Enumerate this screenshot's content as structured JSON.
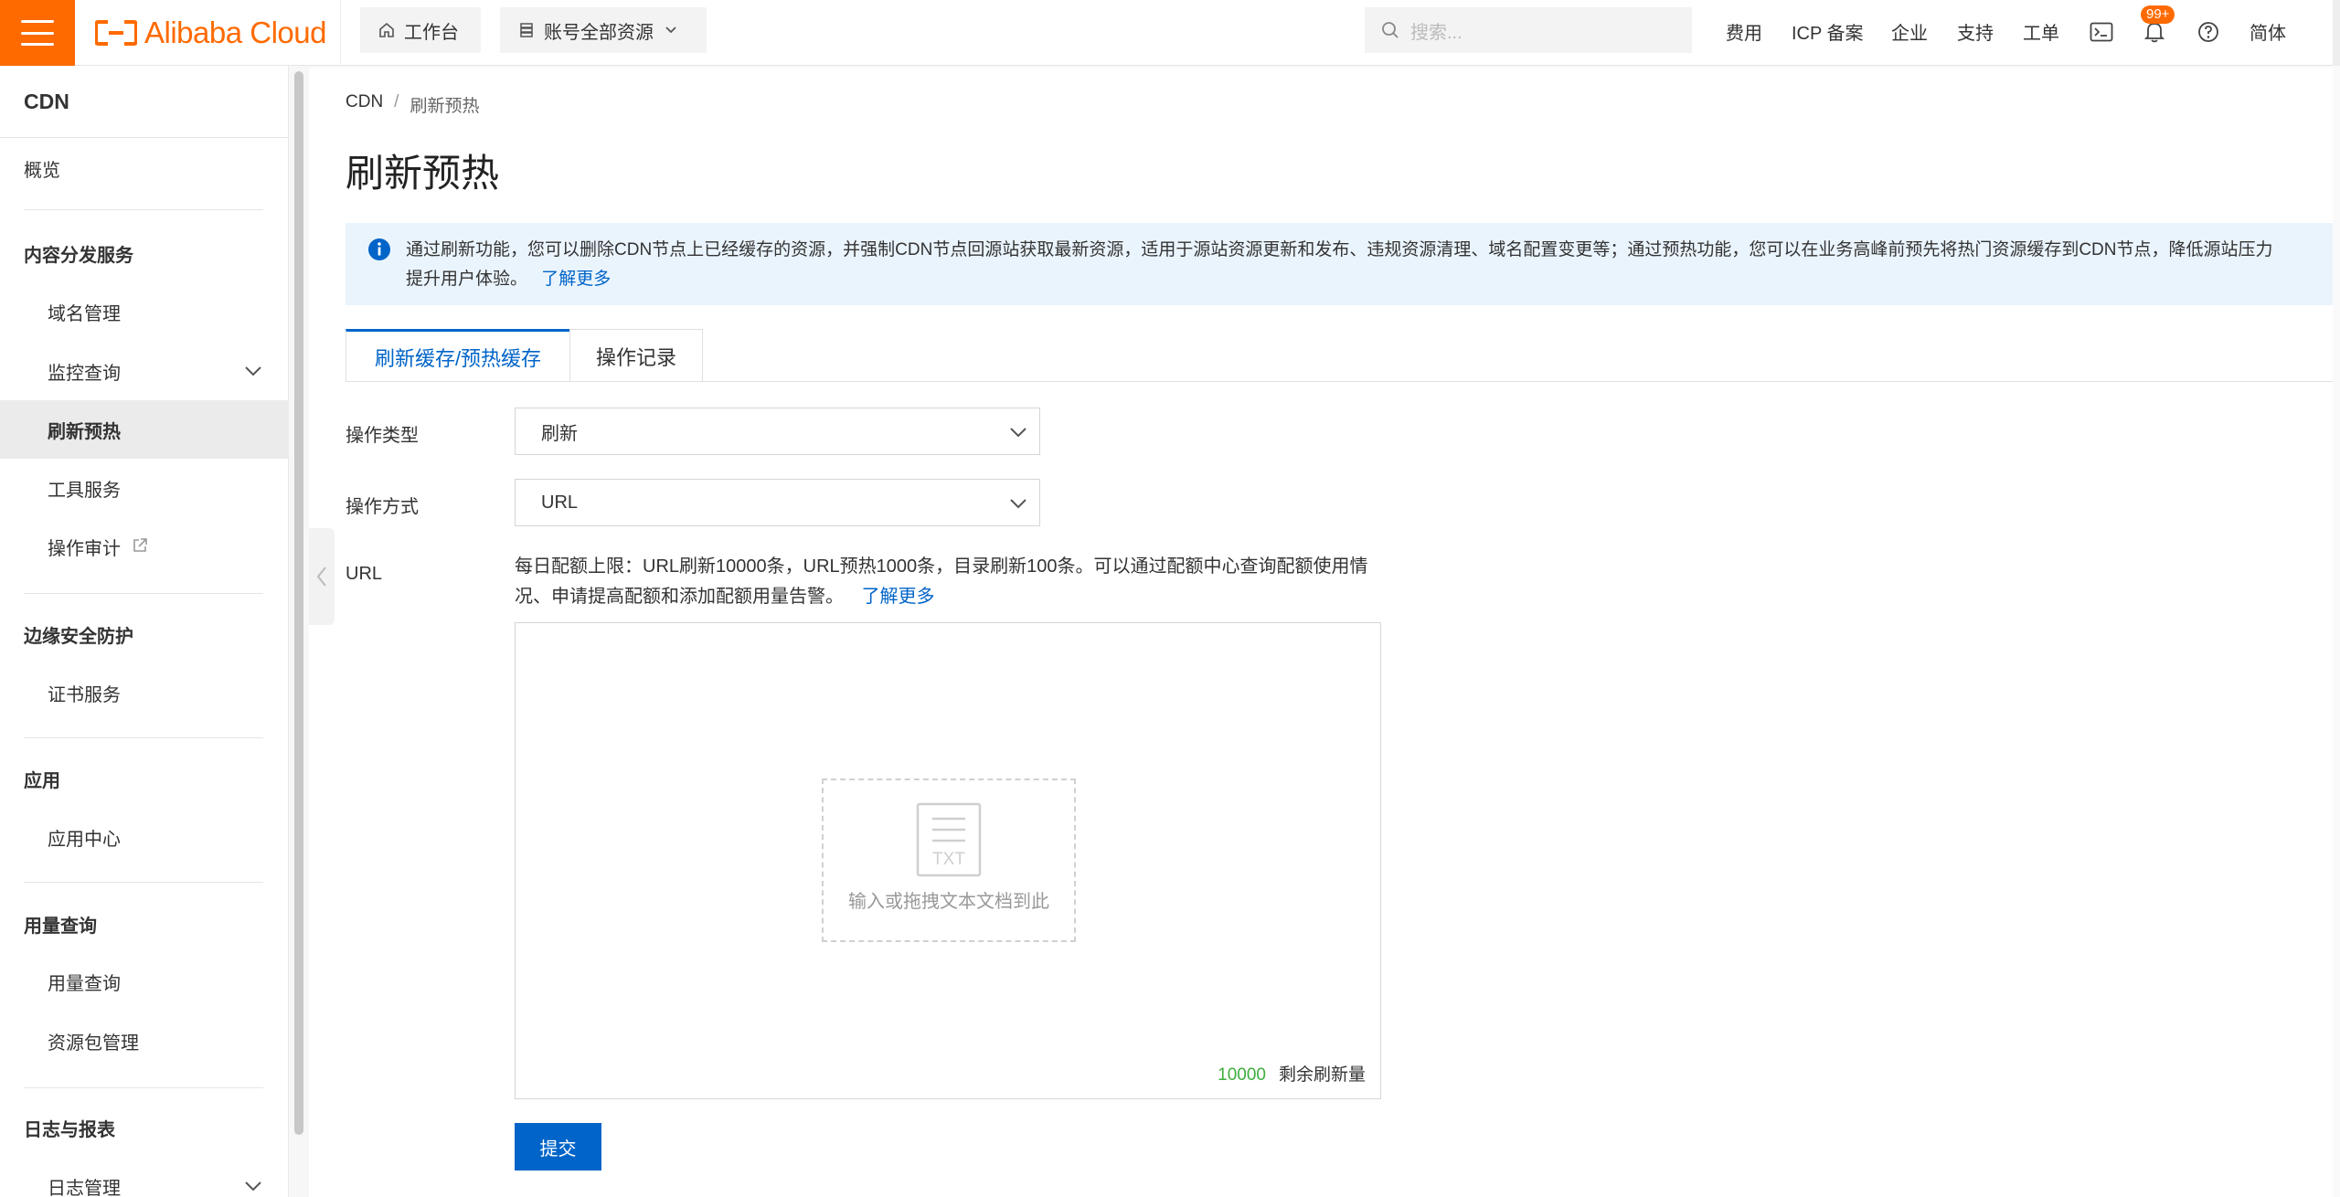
{
  "topbar": {
    "brand": "Alibaba Cloud",
    "workbench": "工作台",
    "resources": "账号全部资源",
    "search_placeholder": "搜索...",
    "links": [
      "费用",
      "ICP 备案",
      "企业",
      "支持",
      "工单"
    ],
    "badge": "99+",
    "language": "简体",
    "accent_color": "#ff6a00"
  },
  "sidebar": {
    "title": "CDN",
    "overview": "概览",
    "groups": [
      {
        "label": "内容分发服务",
        "items": [
          "域名管理",
          "监控查询",
          "刷新预热",
          "工具服务",
          "操作审计"
        ]
      },
      {
        "label": "边缘安全防护",
        "items": [
          "证书服务"
        ]
      },
      {
        "label": "应用",
        "items": [
          "应用中心"
        ]
      },
      {
        "label": "用量查询",
        "items": [
          "用量查询",
          "资源包管理"
        ]
      },
      {
        "label": "日志与报表",
        "items": [
          "日志管理"
        ]
      }
    ],
    "active_item": "刷新预热"
  },
  "breadcrumb": {
    "root": "CDN",
    "separator": "/",
    "current": "刷新预热"
  },
  "page": {
    "title": "刷新预热",
    "notice_line1": "通过刷新功能，您可以删除CDN节点上已经缓存的资源，并强制CDN节点回源站获取最新资源，适用于源站资源更新和发布、违规资源清理、域名配置变更等；通过预热功能，您可以在业务高峰前预先将热门资源缓存到CDN节点，降低源站压力",
    "notice_line2": "提升用户体验。",
    "notice_link": "了解更多",
    "tabs": [
      "刷新缓存/预热缓存",
      "操作记录"
    ],
    "active_tab": 0
  },
  "form": {
    "op_type_label": "操作类型",
    "op_type_value": "刷新",
    "op_mode_label": "操作方式",
    "op_mode_value": "URL",
    "url_label": "URL",
    "quota_line1": "每日配额上限：URL刷新10000条，URL预热1000条，目录刷新100条。可以通过配额中心查询配额使用情",
    "quota_line2": "况、申请提高配额和添加配额用量告警。",
    "quota_link": "了解更多",
    "drop_icon_text": "TXT",
    "drop_text": "输入或拖拽文本文档到此",
    "remaining_count": "10000",
    "remaining_label": "剩余刷新量",
    "submit": "提交",
    "primary_color": "#0064c8"
  }
}
